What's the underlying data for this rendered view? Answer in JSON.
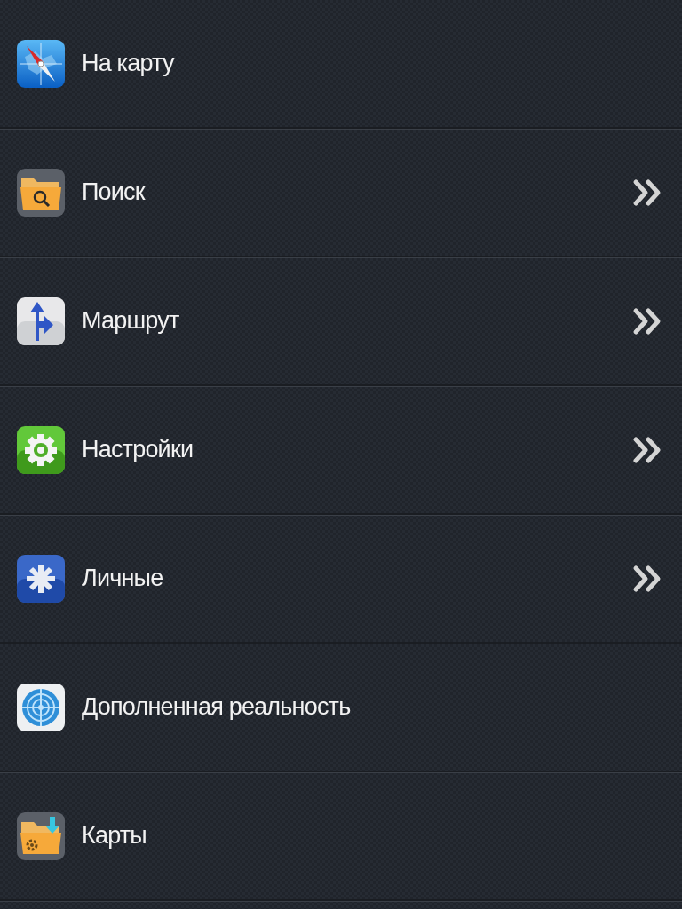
{
  "menu": [
    {
      "label": "На карту",
      "kind": "compass",
      "has_submenu": false
    },
    {
      "label": "Поиск",
      "kind": "search-folder",
      "has_submenu": true
    },
    {
      "label": "Маршрут",
      "kind": "route",
      "has_submenu": true
    },
    {
      "label": "Настройки",
      "kind": "gear",
      "has_submenu": true
    },
    {
      "label": "Личные",
      "kind": "asterisk",
      "has_submenu": true
    },
    {
      "label": "Дополненная реальность",
      "kind": "radar",
      "has_submenu": false
    },
    {
      "label": "Карты",
      "kind": "map-folder",
      "has_submenu": false
    }
  ]
}
